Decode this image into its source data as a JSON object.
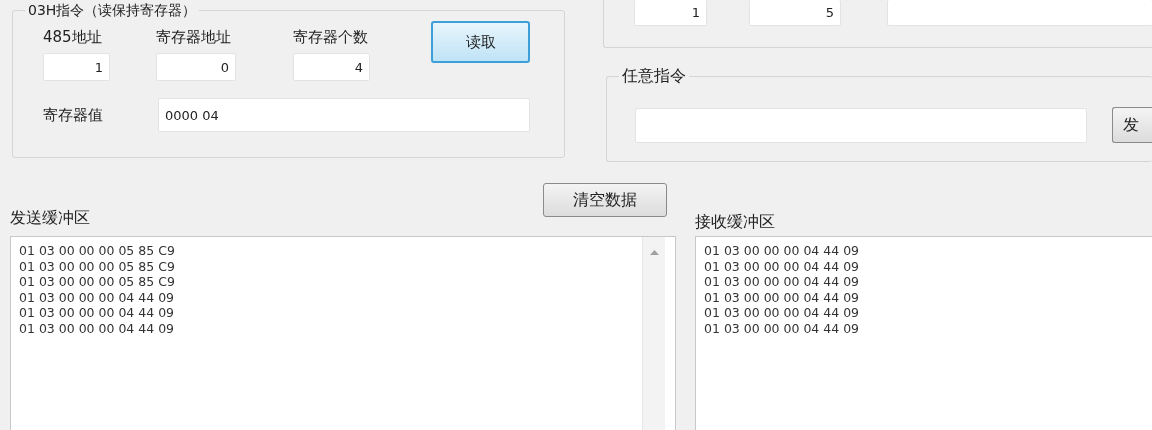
{
  "read_holding_group": {
    "title": "03H指令（读保持寄存器）",
    "fields": [
      {
        "label": "485地址",
        "value": "1"
      },
      {
        "label": "寄存器地址",
        "value": "0"
      },
      {
        "label": "寄存器个数",
        "value": "4"
      }
    ],
    "read_button": "读取",
    "value_label": "寄存器值",
    "value": "0000 04"
  },
  "upper_right_group": {
    "fields": [
      "1",
      "5"
    ]
  },
  "any_command_group": {
    "title": "任意指令",
    "send_button": "发"
  },
  "clear_button": "清空数据",
  "send_buffer": {
    "title": "发送缓冲区",
    "lines": [
      "01 03 00 00 00 05 85 C9",
      "01 03 00 00 00 05 85 C9",
      "01 03 00 00 00 05 85 C9",
      "01 03 00 00 00 04 44 09",
      "01 03 00 00 00 04 44 09",
      "01 03 00 00 00 04 44 09"
    ]
  },
  "receive_buffer": {
    "title": "接收缓冲区",
    "lines": [
      "01 03 00 00 00 04 44 09",
      "01 03 00 00 00 04 44 09",
      "01 03 00 00 00 04 44 09",
      "01 03 00 00 00 04 44 09",
      "01 03 00 00 00 04 44 09",
      "01 03 00 00 00 04 44 09"
    ]
  }
}
